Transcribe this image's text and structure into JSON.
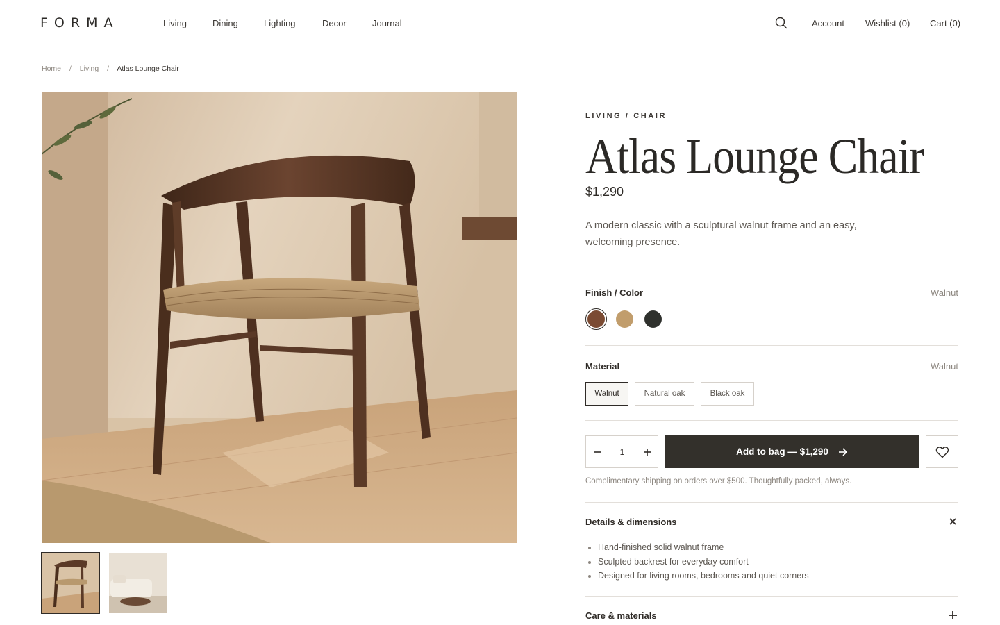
{
  "brand": {
    "logo": "FORMA"
  },
  "nav": [
    "Living",
    "Dining",
    "Lighting",
    "Decor",
    "Journal"
  ],
  "header_right": {
    "account": "Account",
    "wishlist": "Wishlist (0)",
    "cart": "Cart (0)"
  },
  "breadcrumb": {
    "home": "Home",
    "category": "Living",
    "current": "Atlas Lounge Chair",
    "separator": "/"
  },
  "product": {
    "kicker": "LIVING / CHAIR",
    "title": "Atlas Lounge Chair",
    "price": "$1,290",
    "description": "A modern classic with a sculptural walnut frame and an easy, welcoming presence."
  },
  "finish": {
    "label": "Finish / Color",
    "selected": "Walnut",
    "swatches": [
      {
        "name": "walnut",
        "color": "#7b4b33"
      },
      {
        "name": "natural-oak",
        "color": "#c19d6c"
      },
      {
        "name": "black-oak",
        "color": "#2f312d"
      }
    ]
  },
  "material": {
    "label": "Material",
    "selected": "Walnut",
    "options": [
      "Walnut",
      "Natural oak",
      "Black oak"
    ]
  },
  "purchase": {
    "quantity": "1",
    "add_label": "Add to bag — $1,290",
    "shipping_note": "Complimentary shipping on orders over $500. Thoughtfully packed, always."
  },
  "accordion": {
    "details": {
      "title": "Details & dimensions",
      "items": [
        "Hand-finished solid walnut frame",
        "Sculpted backrest for everyday comfort",
        "Designed for living rooms, bedrooms and quiet corners"
      ]
    },
    "care": {
      "title": "Care & materials"
    }
  },
  "colors": {
    "button_dark": "#33302b",
    "text": "#2f2b27",
    "muted": "#8d8780"
  }
}
